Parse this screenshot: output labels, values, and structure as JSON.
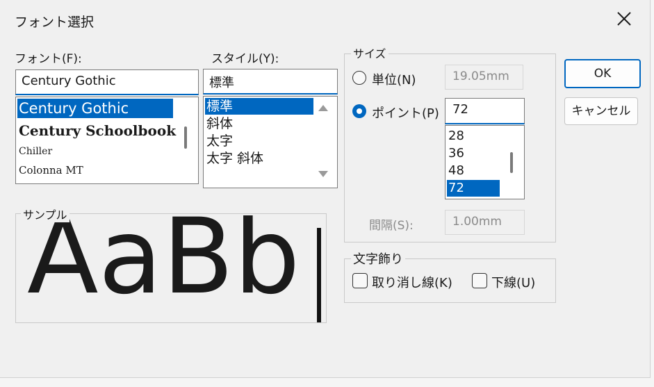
{
  "window": {
    "title": "フォント選択"
  },
  "font": {
    "label": "フォント(F):",
    "value": "Century Gothic",
    "items": [
      "Century Gothic",
      "Century Schoolbook",
      "Chiller",
      "Colonna MT"
    ]
  },
  "style": {
    "label": "スタイル(Y):",
    "value": "標準",
    "items": [
      "標準",
      "斜体",
      "太字",
      "太字 斜体"
    ]
  },
  "size": {
    "group_label": "サイズ",
    "unit_label": "単位(N)",
    "unit_value": "19.05mm",
    "point_label": "ポイント(P)",
    "point_value": "72",
    "items": [
      "28",
      "36",
      "48",
      "72"
    ],
    "spacing_label": "間隔(S):",
    "spacing_value": "1.00mm"
  },
  "decoration": {
    "group_label": "文字飾り",
    "strikeout_label": "取り消し線(K)",
    "underline_label": "下線(U)"
  },
  "sample": {
    "label": "サンプル",
    "text": "AaBb"
  },
  "buttons": {
    "ok": "OK",
    "cancel": "キャンセル"
  },
  "colors": {
    "accent": "#0067c0",
    "background": "#f0f0f0"
  }
}
